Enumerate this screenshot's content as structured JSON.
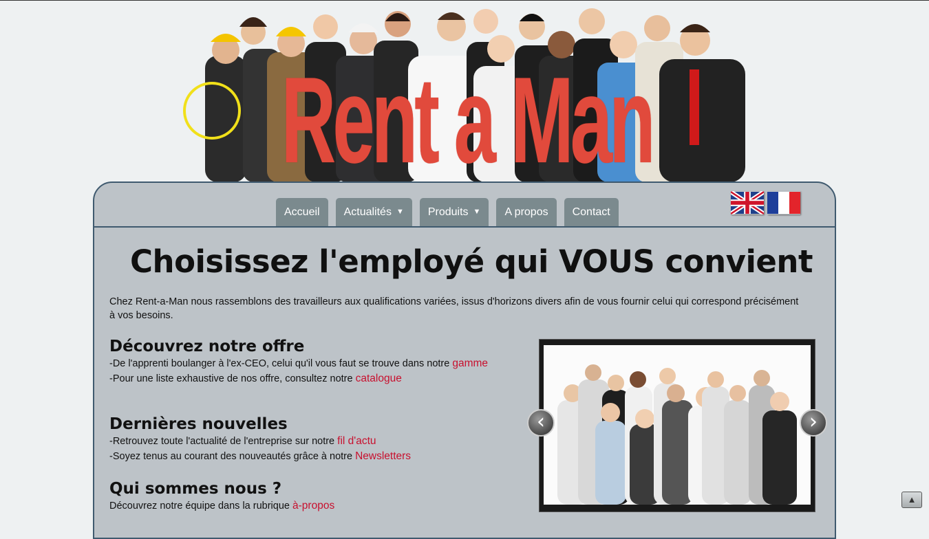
{
  "header": {
    "brand_title": "Rent a Man"
  },
  "nav": {
    "tabs": [
      {
        "label": "Accueil",
        "dropdown": false
      },
      {
        "label": "Actualités",
        "dropdown": true
      },
      {
        "label": "Produits",
        "dropdown": true
      },
      {
        "label": "A propos",
        "dropdown": false
      },
      {
        "label": "Contact",
        "dropdown": false
      }
    ],
    "dropdown_icon": "▼",
    "languages": [
      {
        "name": "english",
        "icon": "uk-flag-icon"
      },
      {
        "name": "french",
        "icon": "france-flag-icon"
      }
    ]
  },
  "main": {
    "headline": "Choisissez l'employé qui VOUS convient",
    "intro": "Chez Rent-a-Man nous rassemblons des travailleurs aux qualifications variées, issus d'horizons divers afin de vous fournir celui qui correspond précisément à vos besoins.",
    "sections": [
      {
        "title": "Découvrez notre offre",
        "lines": [
          {
            "text": "-De l'apprenti boulanger à l'ex-CEO, celui qu'il vous faut se trouve dans notre",
            "link": "gamme"
          },
          {
            "text": "-Pour une liste exhaustive de nos offre, consultez notre",
            "link": "catalogue"
          }
        ]
      },
      {
        "title": "Dernières nouvelles",
        "lines": [
          {
            "text": "-Retrouvez toute l'actualité de l'entreprise sur notre",
            "link": "fil d'actu"
          },
          {
            "text": "-Soyez tenus au courant des nouveautés grâce à notre",
            "link": "Newsletters"
          }
        ]
      },
      {
        "title": "Qui sommes nous ?",
        "lines": [
          {
            "text": "Découvrez notre équipe dans la rubrique",
            "link": "à-propos"
          }
        ]
      }
    ]
  },
  "slider": {
    "prev_icon": "‹",
    "next_icon": "›"
  },
  "back_to_top_icon": "▲",
  "colors": {
    "accent_red": "#e14a3c",
    "link_red": "#c8102e",
    "panel_bg": "#bdc3c8",
    "tab_bg": "#7b8a8e",
    "panel_border": "#3f5a6f"
  }
}
